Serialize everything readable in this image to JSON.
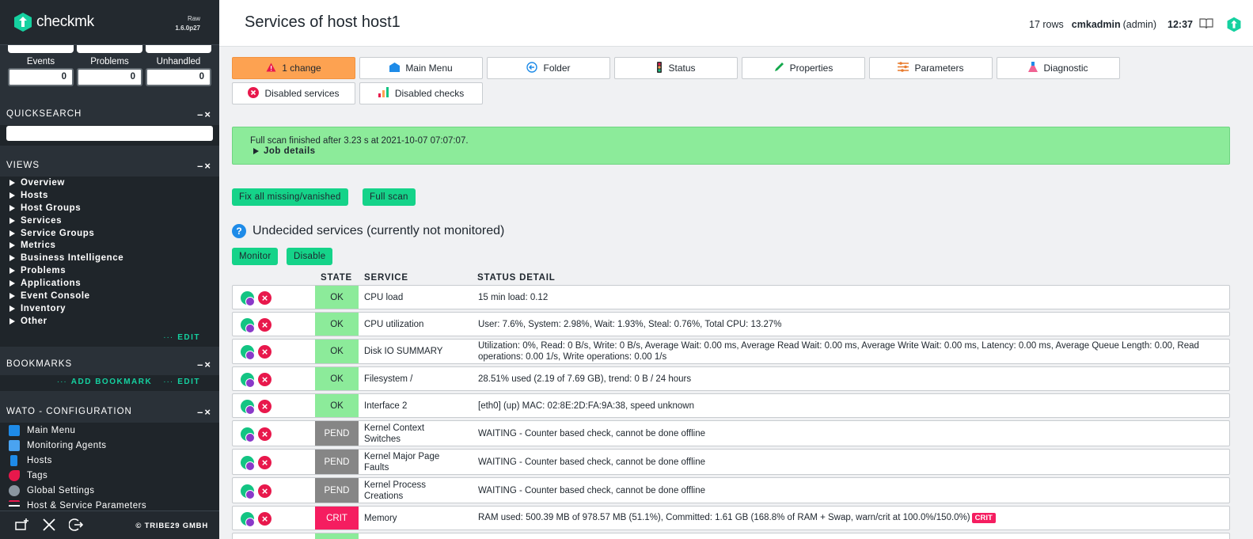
{
  "sidebar": {
    "brand": "checkmk",
    "edition": "Raw",
    "version": "1.6.0p27",
    "stats": [
      {
        "label": "Events",
        "value": "0"
      },
      {
        "label": "Problems",
        "value": "0"
      },
      {
        "label": "Unhandled",
        "value": "0"
      }
    ],
    "quicksearch": {
      "title": "QUICKSEARCH",
      "value": ""
    },
    "views": {
      "title": "VIEWS",
      "items": [
        "Overview",
        "Hosts",
        "Host Groups",
        "Services",
        "Service Groups",
        "Metrics",
        "Business Intelligence",
        "Problems",
        "Applications",
        "Event Console",
        "Inventory",
        "Other"
      ],
      "edit_label": "EDIT"
    },
    "bookmarks": {
      "title": "BOOKMARKS",
      "add_label": "ADD BOOKMARK",
      "edit_label": "EDIT"
    },
    "wato": {
      "title": "WATO - CONFIGURATION",
      "items": [
        {
          "label": "Main Menu",
          "icon": "main-menu-icon",
          "color": "#1e8be8"
        },
        {
          "label": "Monitoring Agents",
          "icon": "agents-icon",
          "color": "#4aa3f0"
        },
        {
          "label": "Hosts",
          "icon": "hosts-icon",
          "color": "#1e8be8"
        },
        {
          "label": "Tags",
          "icon": "tag-icon",
          "color": "#e8184c"
        },
        {
          "label": "Global Settings",
          "icon": "gear-icon",
          "color": "#8a96a0"
        },
        {
          "label": "Host & Service Parameters",
          "icon": "parameters-icon",
          "color": "#e8184c"
        }
      ]
    },
    "snapin_controls": "–×",
    "copyright": "© TRIBE29 GMBH"
  },
  "header": {
    "title": "Services of host host1",
    "rows": "17 rows",
    "user": "cmkadmin",
    "role": "(admin)",
    "time": "12:37"
  },
  "toolbar": {
    "buttons": [
      {
        "label": "1 change",
        "icon": "warning-icon"
      },
      {
        "label": "Main Menu",
        "icon": "main-menu-icon"
      },
      {
        "label": "Folder",
        "icon": "folder-back-icon"
      },
      {
        "label": "Status",
        "icon": "traffic-light-icon"
      },
      {
        "label": "Properties",
        "icon": "pencil-icon"
      },
      {
        "label": "Parameters",
        "icon": "parameters-icon"
      },
      {
        "label": "Diagnostic",
        "icon": "flask-icon"
      }
    ],
    "buttons2": [
      {
        "label": "Disabled services",
        "icon": "disabled-icon"
      },
      {
        "label": "Disabled checks",
        "icon": "bar-chart-icon"
      }
    ]
  },
  "scan": {
    "message": "Full scan finished after 3.23 s at 2021-10-07 07:07:07.",
    "job_details": "Job details"
  },
  "actions": {
    "fix_all": "Fix all missing/vanished",
    "full_scan": "Full scan"
  },
  "section": {
    "title": "Undecided services (currently not monitored)",
    "monitor": "Monitor",
    "disable": "Disable"
  },
  "table": {
    "headers": {
      "state": "STATE",
      "service": "SERVICE",
      "detail": "STATUS DETAIL"
    },
    "rows": [
      {
        "state": "OK",
        "service": "CPU load",
        "detail": "15 min load: 0.12"
      },
      {
        "state": "OK",
        "service": "CPU utilization",
        "detail": "User: 7.6%, System: 2.98%, Wait: 1.93%, Steal: 0.76%, Total CPU: 13.27%"
      },
      {
        "state": "OK",
        "service": "Disk IO SUMMARY",
        "detail": "Utilization: 0%, Read: 0 B/s, Write: 0 B/s, Average Wait: 0.00 ms, Average Read Wait: 0.00 ms, Average Write Wait: 0.00 ms, Latency: 0.00 ms, Average Queue Length: 0.00, Read operations: 0.00 1/s, Write operations: 0.00 1/s"
      },
      {
        "state": "OK",
        "service": "Filesystem /",
        "detail": "28.51% used (2.19 of 7.69 GB), trend: 0 B / 24 hours"
      },
      {
        "state": "OK",
        "service": "Interface 2",
        "detail": "[eth0] (up) MAC: 02:8E:2D:FA:9A:38, speed unknown"
      },
      {
        "state": "PEND",
        "service": "Kernel Context Switches",
        "detail": "WAITING - Counter based check, cannot be done offline"
      },
      {
        "state": "PEND",
        "service": "Kernel Major Page Faults",
        "detail": "WAITING - Counter based check, cannot be done offline"
      },
      {
        "state": "PEND",
        "service": "Kernel Process Creations",
        "detail": "WAITING - Counter based check, cannot be done offline"
      },
      {
        "state": "CRIT",
        "service": "Memory",
        "detail": "RAM used: 500.39 MB of 978.57 MB (51.1%), Committed: 1.61 GB (168.8% of RAM + Swap, warn/crit at 100.0%/150.0%)",
        "tag": "CRIT"
      }
    ]
  },
  "colors": {
    "ok": "#8ceb9a",
    "pend": "#868686",
    "crit": "#f51d60",
    "accent": "#15d389",
    "changes": "#fda251"
  }
}
